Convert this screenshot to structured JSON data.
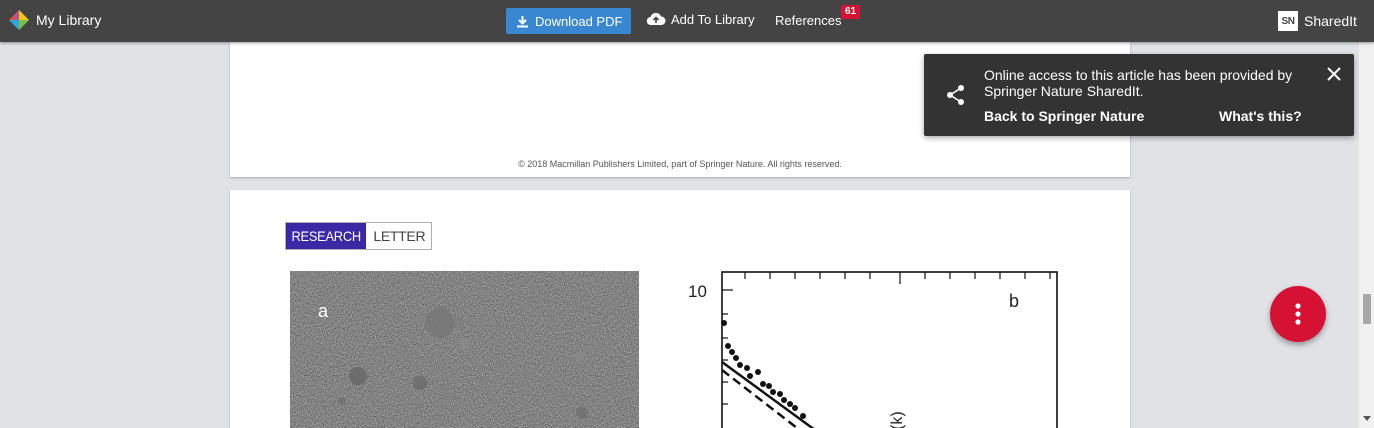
{
  "topbar": {
    "app_title": "My Library",
    "download_label": "Download PDF",
    "add_label": "Add To Library",
    "references_label": "References",
    "references_count": "61",
    "brand_logo": "SN",
    "brand_name": "SharedIt"
  },
  "page1": {
    "copyright": "© 2018 Macmillan Publishers Limited, part of Springer Nature. All rights reserved."
  },
  "page2": {
    "tag_research": "RESEARCH",
    "tag_letter": "LETTER",
    "panel_a_label": "a",
    "panel_b_label": "b",
    "y_tick_top": "10",
    "y_axis_fragment": "(k)"
  },
  "toast": {
    "message": "Online access to this article has been provided by Springer Nature SharedIt.",
    "back_link": "Back to Springer Nature",
    "what_link": "What's this?"
  },
  "colors": {
    "topbar": "#444444",
    "download_button": "#3a87d1",
    "badge": "#d51234",
    "fab": "#d51234",
    "research_tag": "#3b28a4",
    "toast": "#333333"
  },
  "icons": [
    "library-logo-icon",
    "download-icon",
    "cloud-upload-icon",
    "share-icon",
    "close-icon",
    "more-vert-icon"
  ]
}
